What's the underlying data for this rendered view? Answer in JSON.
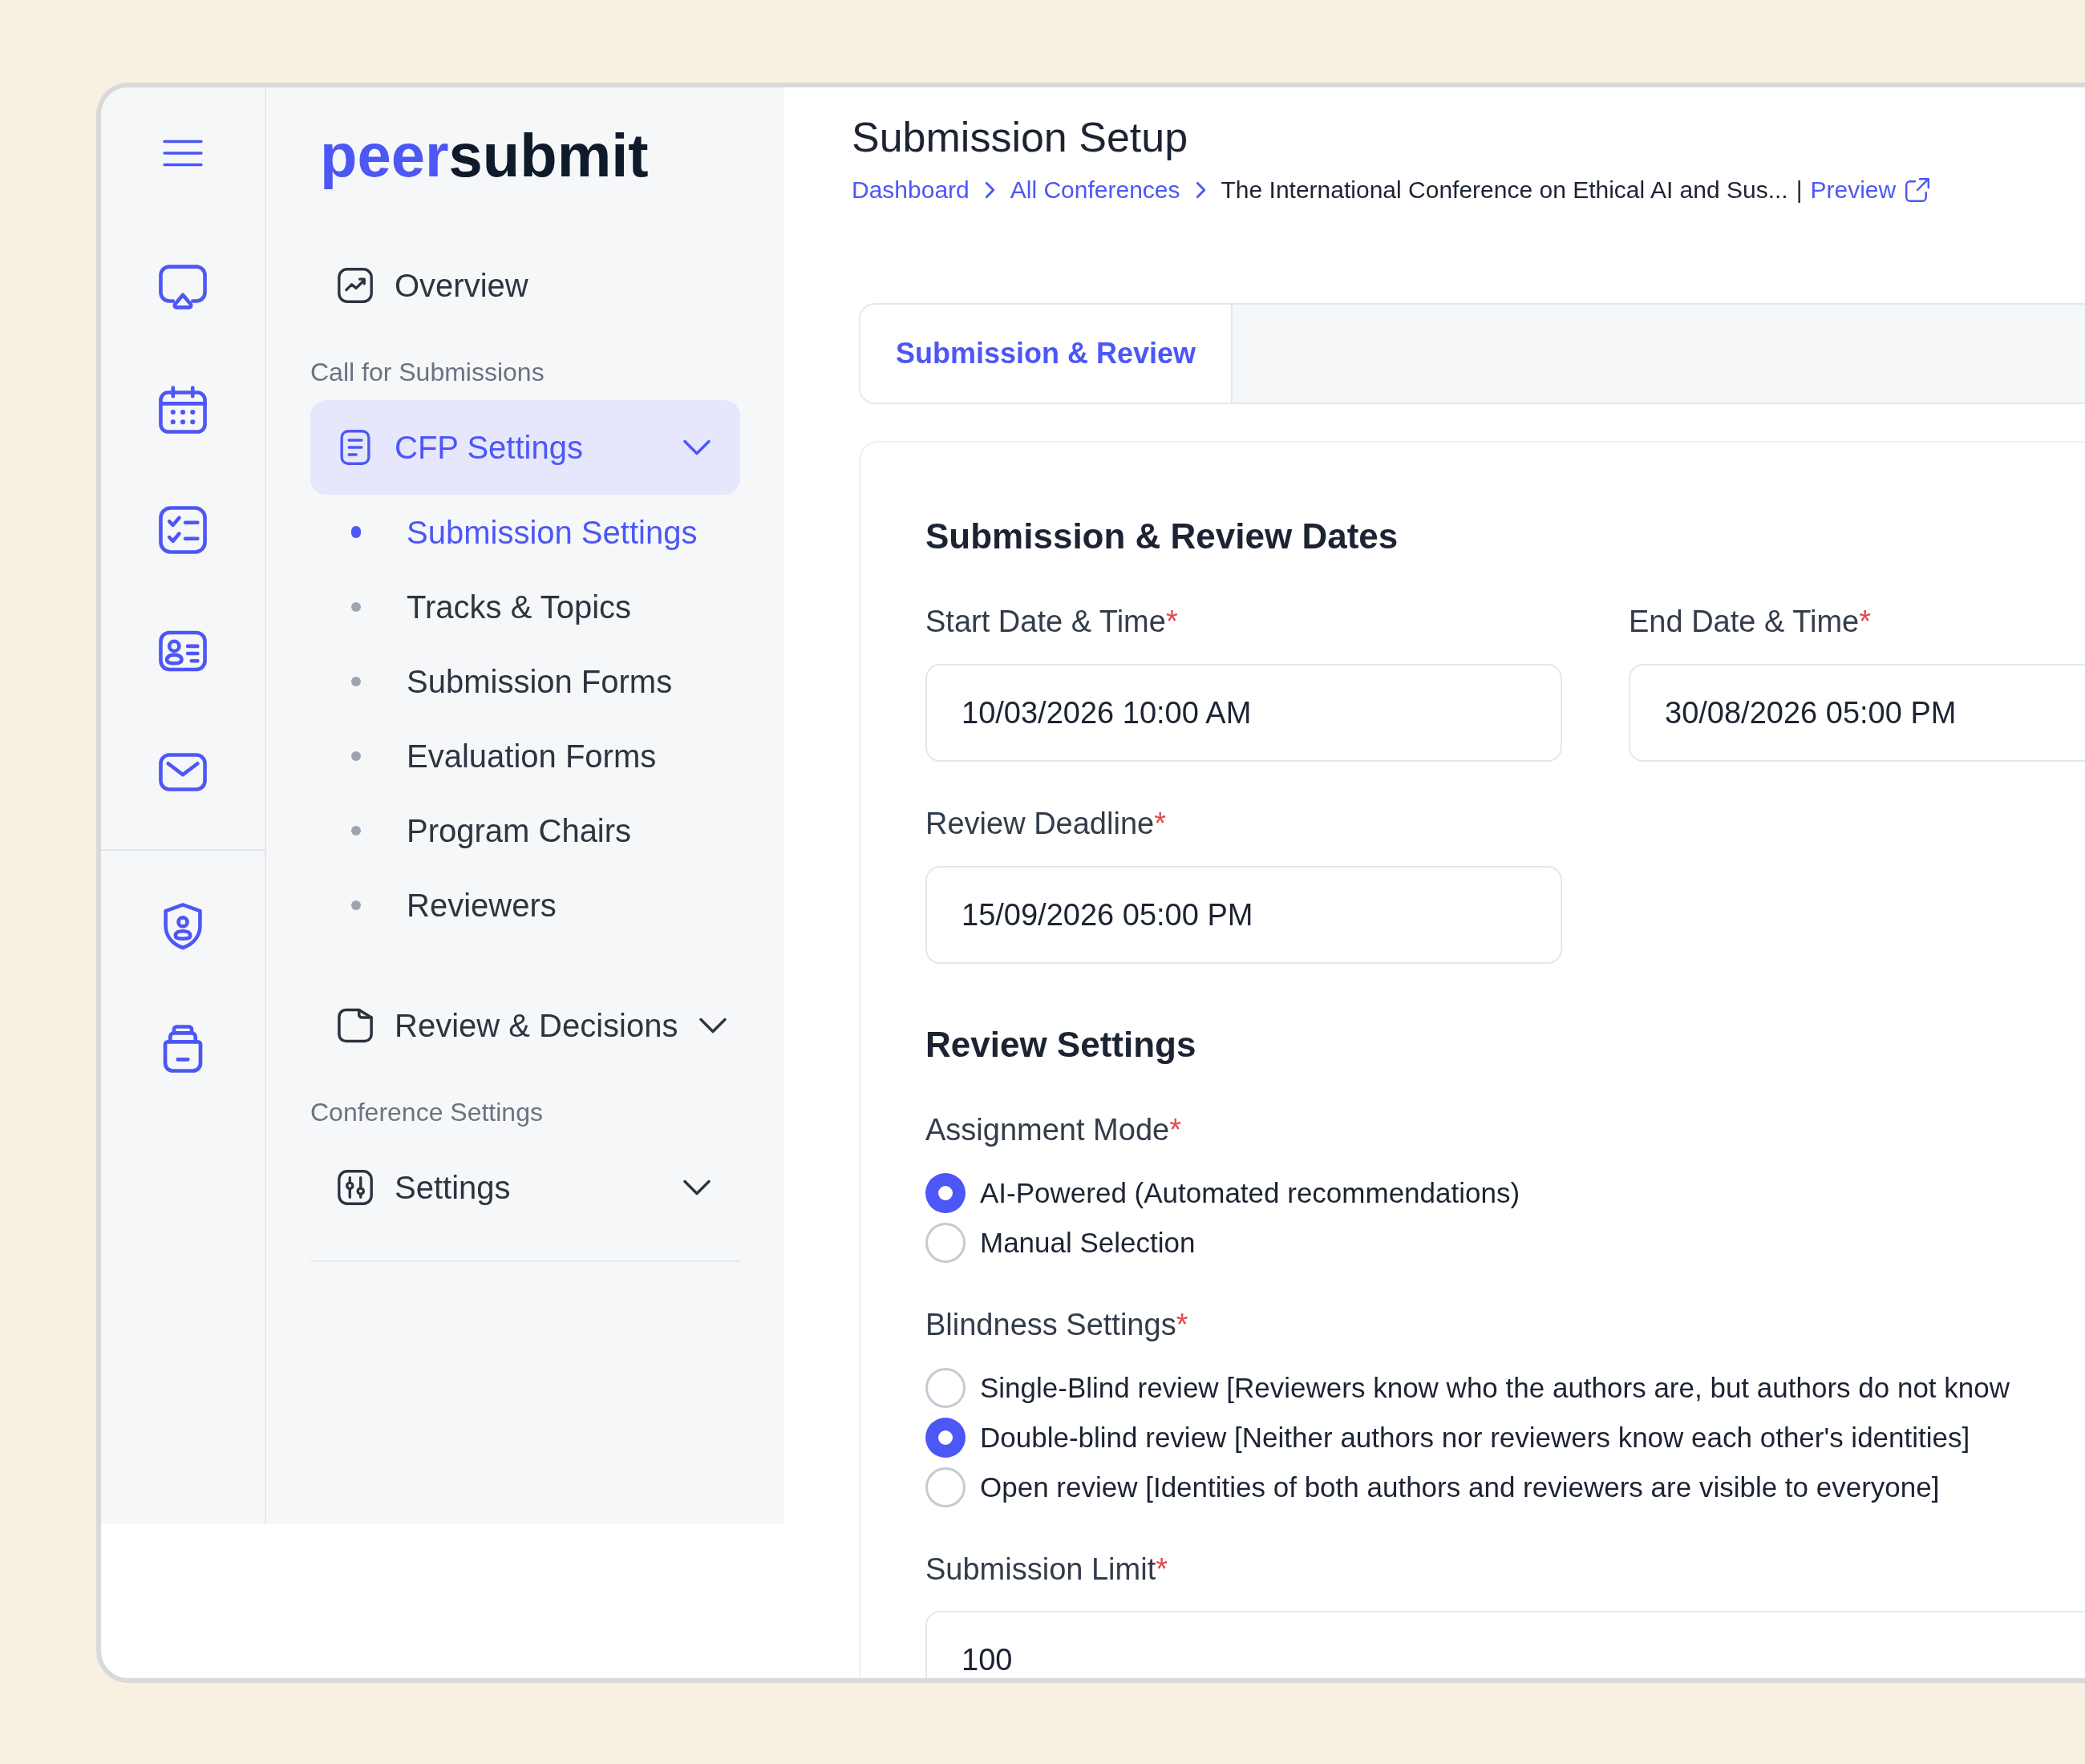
{
  "logo": {
    "lead": "peer",
    "rest": "submit"
  },
  "sidebar": {
    "items": [
      {
        "kind": "link",
        "label": "Overview",
        "selected": false
      },
      {
        "kind": "heading",
        "label": "Call for Submissions"
      },
      {
        "kind": "group",
        "label": "CFP Settings",
        "selected": true,
        "children": [
          {
            "label": "Submission Settings",
            "selected": true
          },
          {
            "label": "Tracks & Topics",
            "selected": false
          },
          {
            "label": "Submission Forms",
            "selected": false
          },
          {
            "label": "Evaluation Forms",
            "selected": false
          },
          {
            "label": "Program Chairs",
            "selected": false
          },
          {
            "label": "Reviewers",
            "selected": false
          }
        ]
      },
      {
        "kind": "group",
        "label": "Review & Decisions",
        "selected": false
      },
      {
        "kind": "heading",
        "label": "Conference Settings"
      },
      {
        "kind": "group",
        "label": "Settings",
        "selected": false
      }
    ]
  },
  "header": {
    "title": "Submission Setup",
    "breadcrumb": [
      {
        "kind": "link",
        "label": "Dashboard"
      },
      {
        "kind": "link",
        "label": "All Conferences"
      },
      {
        "kind": "current",
        "label": "The International Conference on Ethical AI and Sus..."
      }
    ],
    "separator": "|",
    "preview_link": "Preview"
  },
  "tabs": [
    {
      "label": "Submission & Review",
      "selected": true
    }
  ],
  "sections": [
    {
      "kind": "grid",
      "title": "Submission & Review Dates",
      "fields": [
        {
          "kind": "input",
          "label": "Start Date & Time",
          "required_mark": "*",
          "value": "10/03/2026 10:00 AM"
        },
        {
          "kind": "input",
          "label": "End Date & Time",
          "required_mark": "*",
          "value": "30/08/2026 05:00 PM"
        },
        {
          "kind": "input",
          "label": "Review Deadline",
          "required_mark": "*",
          "value": "15/09/2026 05:00 PM"
        }
      ]
    },
    {
      "kind": "stack",
      "title": "Review Settings",
      "fields": [
        {
          "kind": "radio",
          "label": "Assignment Mode",
          "required_mark": "*",
          "options": [
            {
              "label": "AI-Powered (Automated recommendations)",
              "selected": true
            },
            {
              "label": "Manual Selection",
              "selected": false
            }
          ]
        },
        {
          "kind": "radio",
          "label": "Blindness Settings",
          "required_mark": "*",
          "options": [
            {
              "label": "Single-Blind review [Reviewers know who the authors are, but authors do not know",
              "selected": false
            },
            {
              "label": "Double-blind review [Neither authors nor reviewers know each other's identities]",
              "selected": true
            },
            {
              "label": "Open review [Identities of both authors and reviewers are visible to everyone]",
              "selected": false
            }
          ]
        },
        {
          "kind": "input",
          "label": "Submission Limit",
          "required_mark": "*",
          "value": "100"
        }
      ]
    }
  ]
}
